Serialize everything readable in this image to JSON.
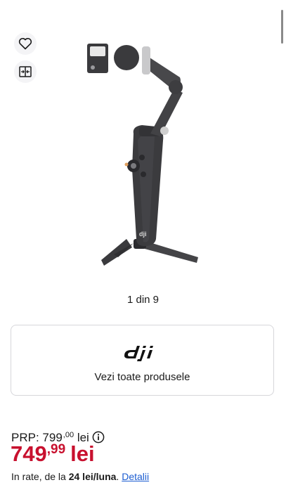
{
  "actions": {
    "favorite_icon": "heart-icon",
    "compare_icon": "compare-icon"
  },
  "gallery": {
    "counter": "1 din 9",
    "image_alt": "DJI Osmo Mobile gimbal",
    "logo_text": "dji"
  },
  "brand_card": {
    "logo": "dji",
    "link_label": "Vezi toate produsele"
  },
  "pricing": {
    "prp_label": "PRP:",
    "prp_integer": "799",
    "prp_decimals": ",00",
    "prp_currency": "lei",
    "price_integer": "749",
    "price_decimals": ",99",
    "price_currency": "lei",
    "installment_prefix": "In rate, de la",
    "installment_amount": "24 lei/luna",
    "installment_suffix": ".",
    "details_link": "Detalii"
  },
  "colors": {
    "price_red": "#c8102e",
    "link_blue": "#1c5dd1",
    "border": "#d6d6da"
  }
}
